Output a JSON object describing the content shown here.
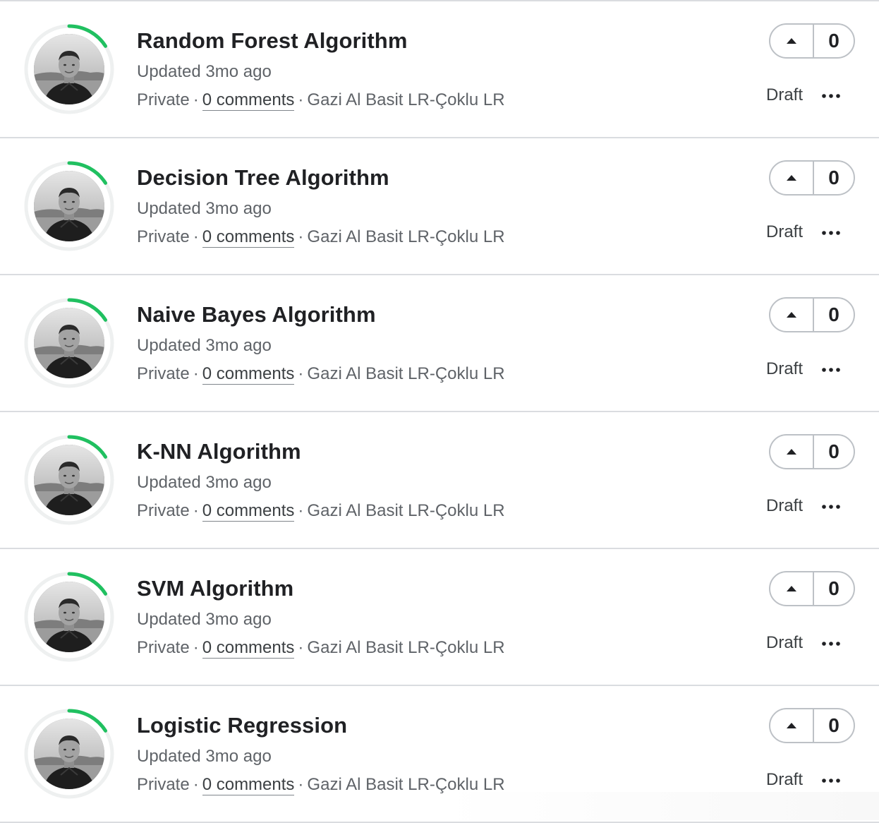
{
  "items": [
    {
      "title": "Random Forest Algorithm",
      "updated": "Updated 3mo ago",
      "visibility": "Private",
      "comments": "0 comments",
      "source": "Gazi Al Basit LR-Çoklu LR",
      "votes": "0",
      "status": "Draft",
      "separator": "·"
    },
    {
      "title": "Decision Tree Algorithm",
      "updated": "Updated 3mo ago",
      "visibility": "Private",
      "comments": "0 comments",
      "source": "Gazi Al Basit LR-Çoklu LR",
      "votes": "0",
      "status": "Draft",
      "separator": "·"
    },
    {
      "title": "Naive Bayes Algorithm",
      "updated": "Updated 3mo ago",
      "visibility": "Private",
      "comments": "0 comments",
      "source": "Gazi Al Basit LR-Çoklu LR",
      "votes": "0",
      "status": "Draft",
      "separator": "·"
    },
    {
      "title": "K-NN Algorithm",
      "updated": "Updated 3mo ago",
      "visibility": "Private",
      "comments": "0 comments",
      "source": "Gazi Al Basit LR-Çoklu LR",
      "votes": "0",
      "status": "Draft",
      "separator": "·"
    },
    {
      "title": "SVM Algorithm",
      "updated": "Updated 3mo ago",
      "visibility": "Private",
      "comments": "0 comments",
      "source": "Gazi Al Basit LR-Çoklu LR",
      "votes": "0",
      "status": "Draft",
      "separator": "·"
    },
    {
      "title": "Logistic Regression",
      "updated": "Updated 3mo ago",
      "visibility": "Private",
      "comments": "0 comments",
      "source": "Gazi Al Basit LR-Çoklu LR",
      "votes": "0",
      "status": "Draft",
      "separator": "·"
    }
  ],
  "icons": {
    "upvote": "caret-up-icon",
    "more": "more-horizontal-icon",
    "progress_ring": "progress-ring"
  },
  "colors": {
    "progress_ring": "#20BEFF",
    "progress_ring_green": "#20C060",
    "ring_track": "#EEF0F0"
  },
  "progress_ring_fraction": 0.16
}
